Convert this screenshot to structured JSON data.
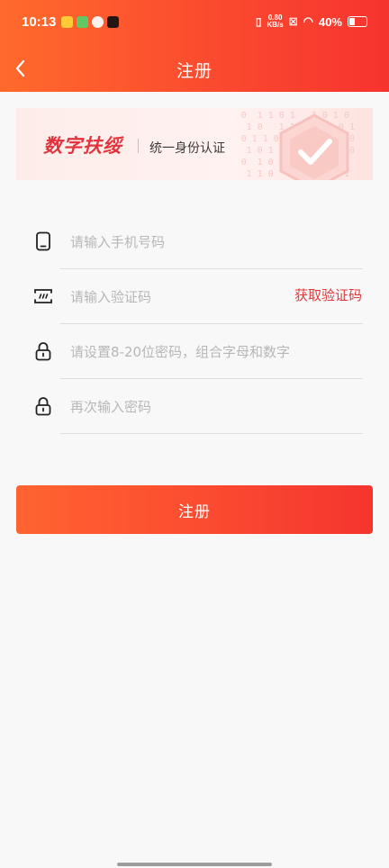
{
  "status": {
    "time": "10:13",
    "net_speed_value": "0.80",
    "net_speed_unit": "KB/s",
    "battery": "40%",
    "battery_level": 0.4
  },
  "header": {
    "title": "注册"
  },
  "banner": {
    "brand": "数字扶绥",
    "subtitle": "统一身份认证"
  },
  "form": {
    "phone_placeholder": "请输入手机号码",
    "code_placeholder": "请输入验证码",
    "get_code_label": "获取验证码",
    "password_placeholder": "请设置8-20位密码，组合字母和数字",
    "confirm_placeholder": "再次输入密码"
  },
  "actions": {
    "submit_label": "注册"
  },
  "colors": {
    "accent": "#f6342f",
    "accent_start": "#ff6a2c",
    "link": "#e0393b"
  }
}
